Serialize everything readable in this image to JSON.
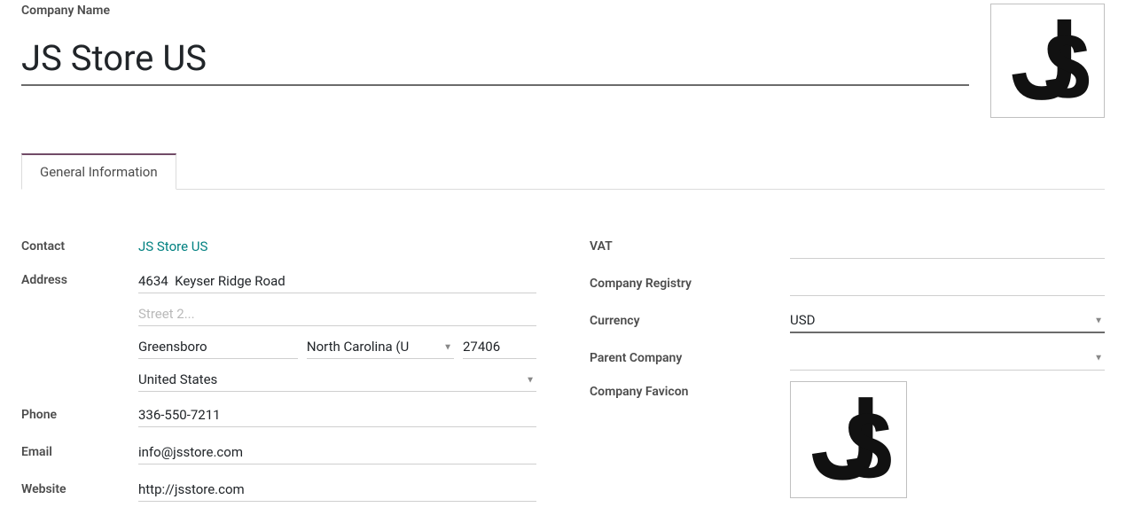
{
  "header": {
    "company_name_label": "Company Name",
    "company_name_value": "JS Store US"
  },
  "tabs": {
    "general": "General Information"
  },
  "left": {
    "contact_label": "Contact",
    "contact_value": "JS Store US",
    "address_label": "Address",
    "street1": "4634  Keyser Ridge Road",
    "street2_placeholder": "Street 2...",
    "city": "Greensboro",
    "state": "North Carolina (U",
    "zip": "27406",
    "country": "United States",
    "phone_label": "Phone",
    "phone_value": "336-550-7211",
    "email_label": "Email",
    "email_value": "info@jsstore.com",
    "website_label": "Website",
    "website_value": "http://jsstore.com"
  },
  "right": {
    "vat_label": "VAT",
    "vat_value": "",
    "registry_label": "Company Registry",
    "registry_value": "",
    "currency_label": "Currency",
    "currency_value": "USD",
    "parent_label": "Parent Company",
    "parent_value": "",
    "favicon_label": "Company Favicon"
  }
}
